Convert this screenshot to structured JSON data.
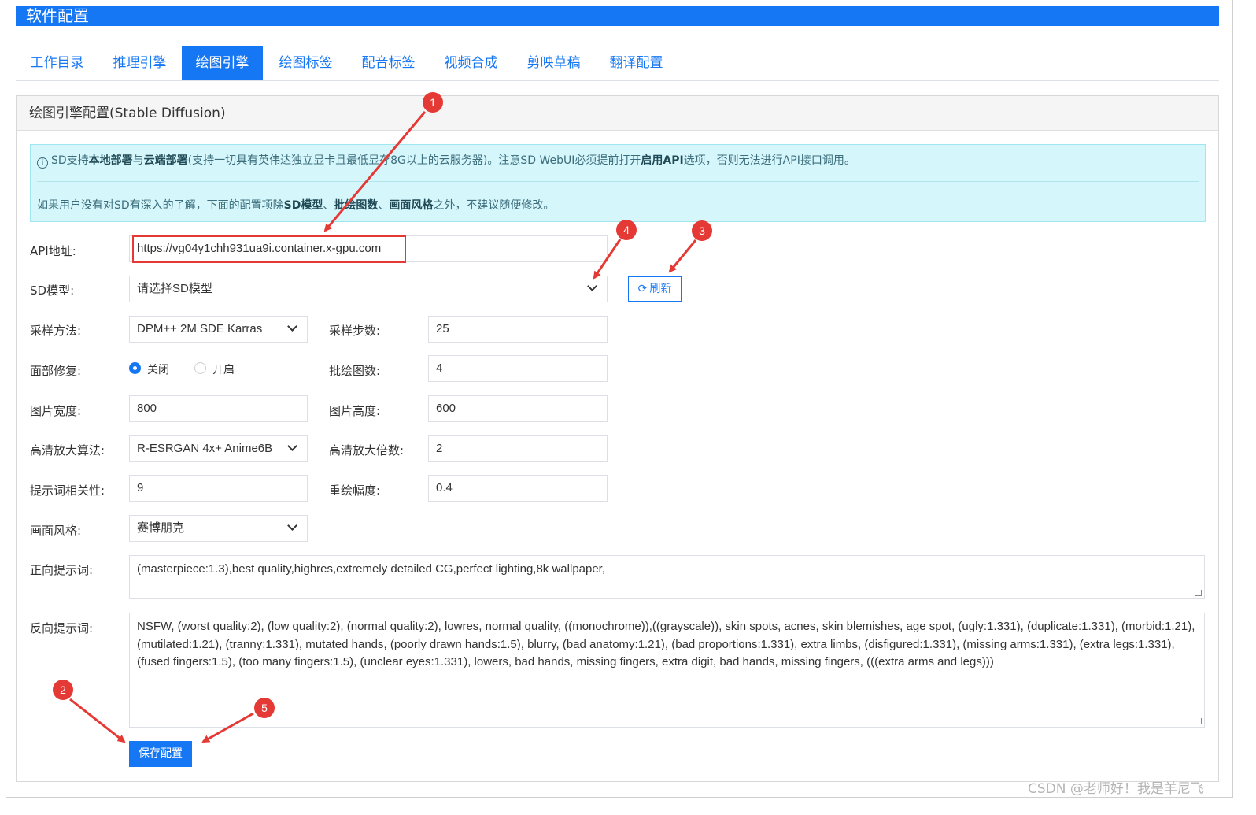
{
  "app": {
    "title": "软件配置"
  },
  "tabs": [
    {
      "label": "工作目录",
      "active": false
    },
    {
      "label": "推理引擎",
      "active": false
    },
    {
      "label": "绘图引擎",
      "active": true
    },
    {
      "label": "绘图标签",
      "active": false
    },
    {
      "label": "配音标签",
      "active": false
    },
    {
      "label": "视频合成",
      "active": false
    },
    {
      "label": "剪映草稿",
      "active": false
    },
    {
      "label": "翻译配置",
      "active": false
    }
  ],
  "panel": {
    "title": "绘图引擎配置(Stable Diffusion)"
  },
  "alert": {
    "icon": "info-circle-icon",
    "line1": [
      "SD支持",
      "本地部署",
      "与",
      "云端部署",
      "(支持一切具有英伟达独立显卡且最低显存8G以上的云服务器)。注意SD WebUI必须提前打开",
      "启用API",
      "选项，否则无法进行API接口调用。"
    ],
    "line2": [
      "如果用户没有对SD有深入的了解，下面的配置项除",
      "SD模型",
      "、",
      "批绘图数",
      "、",
      "画面风格",
      "之外，不建议随便修改。"
    ]
  },
  "form": {
    "api_label": "API地址:",
    "api_value": "https://vg04y1chh931ua9i.container.x-gpu.com",
    "model_label": "SD模型:",
    "model_placeholder": "请选择SD模型",
    "refresh_label": "刷新",
    "sampler_label": "采样方法:",
    "sampler_value": "DPM++ 2M SDE Karras",
    "steps_label": "采样步数:",
    "steps_value": "25",
    "face_label": "面部修复:",
    "face_off": "关闭",
    "face_on": "开启",
    "face_selected": "关闭",
    "batch_label": "批绘图数:",
    "batch_value": "4",
    "width_label": "图片宽度:",
    "width_value": "800",
    "height_label": "图片高度:",
    "height_value": "600",
    "upscaler_label": "高清放大算法:",
    "upscaler_value": "R-ESRGAN 4x+ Anime6B",
    "scale_label": "高清放大倍数:",
    "scale_value": "2",
    "cfg_label": "提示词相关性:",
    "cfg_value": "9",
    "denoise_label": "重绘幅度:",
    "denoise_value": "0.4",
    "style_label": "画面风格:",
    "style_value": "赛博朋克",
    "positive_label": "正向提示词:",
    "positive_value": "(masterpiece:1.3),best quality,highres,extremely detailed CG,perfect lighting,8k wallpaper,",
    "negative_label": "反向提示词:",
    "negative_value": "NSFW, (worst quality:2), (low quality:2), (normal quality:2), lowres, normal quality, ((monochrome)),((grayscale)), skin spots, acnes, skin blemishes, age spot, (ugly:1.331), (duplicate:1.331), (morbid:1.21), (mutilated:1.21), (tranny:1.331), mutated hands, (poorly drawn hands:1.5), blurry, (bad anatomy:1.21), (bad proportions:1.331), extra limbs, (disfigured:1.331), (missing arms:1.331), (extra legs:1.331), (fused fingers:1.5), (too many fingers:1.5), (unclear eyes:1.331), lowers, bad hands, missing fingers, extra digit, bad hands, missing fingers, (((extra arms and legs)))",
    "save_label": "保存配置"
  },
  "annotations": {
    "badges": [
      "1",
      "2",
      "3",
      "4",
      "5"
    ],
    "color": "#e53935"
  },
  "watermark": "CSDN @老师好！我是羊尼飞",
  "colors": {
    "accent": "#1677f5",
    "alert_bg": "#d5f6fb",
    "annotation": "#e53935"
  }
}
